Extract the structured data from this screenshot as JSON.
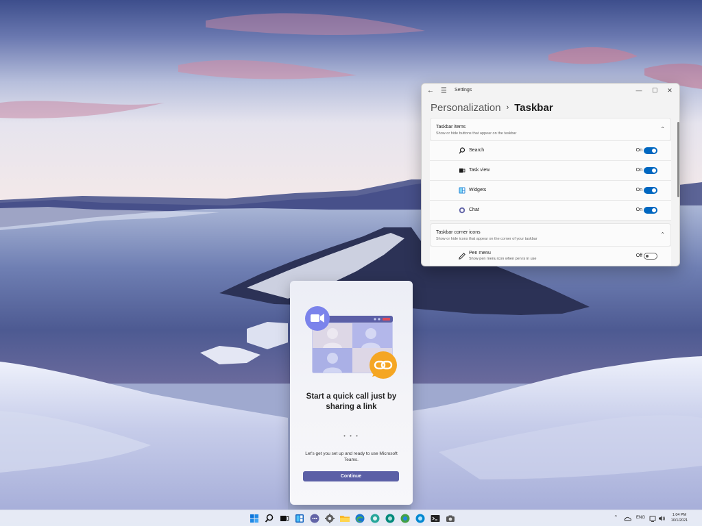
{
  "settings": {
    "window_title": "Settings",
    "breadcrumb_parent": "Personalization",
    "breadcrumb_separator": "›",
    "breadcrumb_current": "Taskbar",
    "sections": [
      {
        "title": "Taskbar items",
        "subtitle": "Show or hide buttons that appear on the taskbar",
        "items": [
          {
            "label": "Search",
            "icon": "search-icon",
            "state": "On"
          },
          {
            "label": "Task view",
            "icon": "task-view-icon",
            "state": "On"
          },
          {
            "label": "Widgets",
            "icon": "widgets-icon",
            "state": "On"
          },
          {
            "label": "Chat",
            "icon": "chat-icon",
            "state": "On"
          }
        ]
      },
      {
        "title": "Taskbar corner icons",
        "subtitle": "Show or hide icons that appear on the corner of your taskbar",
        "items": [
          {
            "label": "Pen menu",
            "subtitle": "Show pen menu icon when pen is in use",
            "icon": "pen-icon",
            "state": "Off"
          }
        ]
      }
    ]
  },
  "teams": {
    "heading": "Start a quick call just by sharing a link",
    "dots": "• • •",
    "description": "Let's get you set up and ready to use Microsoft Teams.",
    "button_label": "Continue",
    "colors": {
      "accent": "#5b5fa6",
      "video": "#7b83eb",
      "link": "#f5a623"
    }
  },
  "taskbar": {
    "apps": [
      "start-icon",
      "search-icon",
      "task-view-icon",
      "widgets-icon",
      "chat-icon",
      "settings-icon",
      "file-explorer-icon",
      "edge-icon",
      "edge-beta-icon",
      "edge-dev-icon",
      "edge-canary-icon",
      "terminal-icon",
      "camera-icon"
    ],
    "tray": {
      "language": "ENG",
      "time": "1:04 PM",
      "date": "10/1/2021"
    }
  },
  "colors": {
    "toggle_on": "#0067c0"
  }
}
